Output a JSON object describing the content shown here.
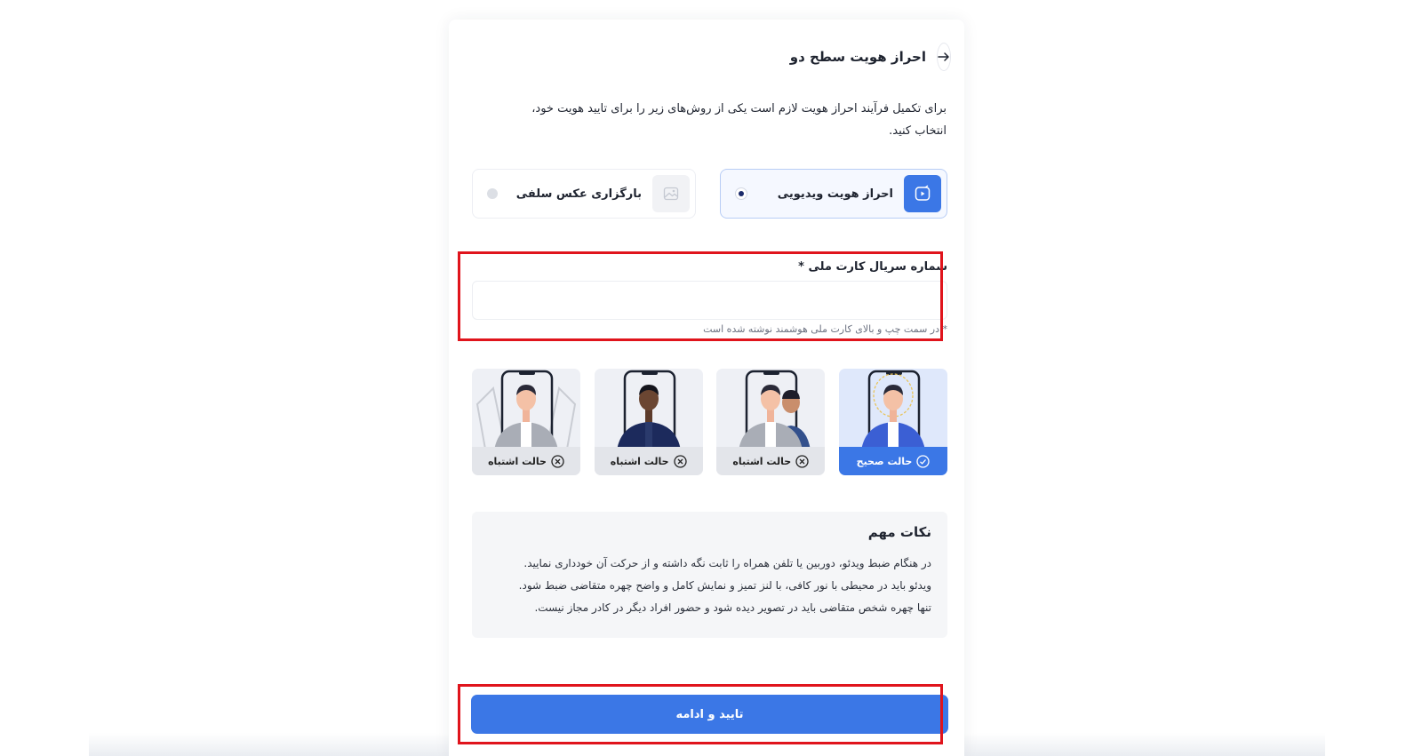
{
  "header": {
    "title": "احراز هویت سطح دو",
    "back_icon": "arrow-right-icon"
  },
  "intro": {
    "line1": "برای تکمیل فرآیند احراز هویت لازم است یکی از روش‌های زیر را برای تایید هویت خود،",
    "line2": "انتخاب کنید."
  },
  "methods": [
    {
      "label": "احراز هویت ویدیویی",
      "icon": "video-camera-icon",
      "selected": true
    },
    {
      "label": "بارگزاری عکس سلفی",
      "icon": "image-upload-icon",
      "selected": false
    }
  ],
  "serial": {
    "label": "شماره سریال کارت ملی *",
    "value": "",
    "placeholder": "",
    "hint": "* در سمت چپ و بالای کارت ملی هوشمند نوشته شده است"
  },
  "examples": [
    {
      "label": "حالت صحیح",
      "status": "correct",
      "icon": "check-circle-icon"
    },
    {
      "label": "حالت اشتباه",
      "status": "wrong",
      "icon": "x-circle-icon"
    },
    {
      "label": "حالت اشتباه",
      "status": "wrong",
      "icon": "x-circle-icon"
    },
    {
      "label": "حالت اشتباه",
      "status": "wrong",
      "icon": "x-circle-icon"
    }
  ],
  "notes": {
    "title": "نکات مهم",
    "lines": [
      "در هنگام ضبط ویدئو، دوربین یا تلفن همراه را ثابت نگه داشته و از حرکت آن خودداری نمایید.",
      "ویدئو باید در محیطی با نور کافی، با لنز تمیز و نمایش کامل و واضح چهره متقاضی ضبط شود.",
      "تنها چهره شخص متقاضی باید در تصویر دیده شود و حضور افراد دیگر در کادر مجاز نیست."
    ]
  },
  "submit": {
    "label": "تایید و ادامه"
  },
  "colors": {
    "accent": "#3b77e6",
    "highlight": "#e0141c"
  }
}
